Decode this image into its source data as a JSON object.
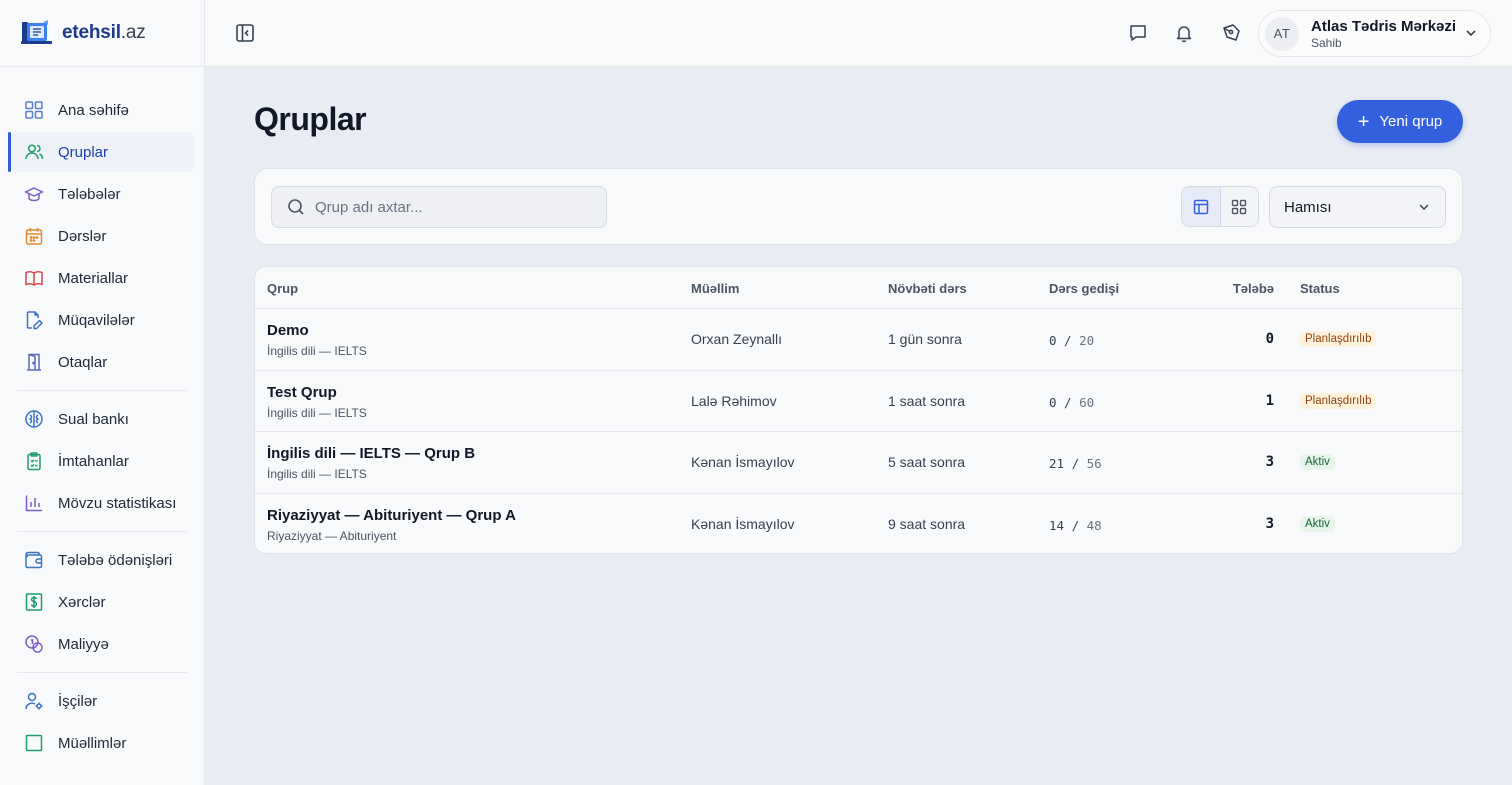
{
  "brand": {
    "name": "etehsil",
    "tld": ".az"
  },
  "sidebar": {
    "groups": [
      [
        {
          "label": "Ana səhifə",
          "icon": "grid-icon",
          "active": false
        },
        {
          "label": "Qruplar",
          "icon": "users-icon",
          "active": true
        },
        {
          "label": "Tələbələr",
          "icon": "graduation-cap-icon",
          "active": false
        },
        {
          "label": "Dərslər",
          "icon": "calendar-icon",
          "active": false
        },
        {
          "label": "Materiallar",
          "icon": "book-icon",
          "active": false
        },
        {
          "label": "Müqavilələr",
          "icon": "contract-icon",
          "active": false
        },
        {
          "label": "Otaqlar",
          "icon": "door-icon",
          "active": false
        }
      ],
      [
        {
          "label": "Sual bankı",
          "icon": "brain-icon",
          "active": false
        },
        {
          "label": "İmtahanlar",
          "icon": "clipboard-icon",
          "active": false
        },
        {
          "label": "Mövzu statistikası",
          "icon": "bar-chart-icon",
          "active": false
        }
      ],
      [
        {
          "label": "Tələbə ödənişləri",
          "icon": "wallet-icon",
          "active": false
        },
        {
          "label": "Xərclər",
          "icon": "dollar-icon",
          "active": false
        },
        {
          "label": "Maliyyə",
          "icon": "coins-icon",
          "active": false
        }
      ],
      [
        {
          "label": "İşçilər",
          "icon": "user-gear-icon",
          "active": false
        },
        {
          "label": "Müəllimlər",
          "icon": "teacher-icon",
          "active": false
        }
      ]
    ]
  },
  "user": {
    "initials": "AT",
    "name": "Atlas Tədris Mərkəzi",
    "role": "Sahib"
  },
  "page": {
    "title": "Qruplar",
    "new_button": "Yeni qrup"
  },
  "filters": {
    "search_placeholder": "Qrup adı axtar...",
    "status_value": "Hamısı"
  },
  "table": {
    "headers": {
      "group": "Qrup",
      "teacher": "Müəllim",
      "next": "Növbəti dərs",
      "progress": "Dərs gedişi",
      "students": "Tələbə",
      "status": "Status"
    },
    "rows": [
      {
        "name": "Demo",
        "course": "İngilis dili — IELTS",
        "teacher": "Orxan Zeynallı",
        "next": "1 gün sonra",
        "done": "0",
        "total": "20",
        "students": "0",
        "status": "Planlaşdırılıb",
        "status_kind": "planned"
      },
      {
        "name": "Test Qrup",
        "course": "İngilis dili — IELTS",
        "teacher": "Lalə Rəhimov",
        "next": "1 saat sonra",
        "done": "0",
        "total": "60",
        "students": "1",
        "status": "Planlaşdırılıb",
        "status_kind": "planned"
      },
      {
        "name": "İngilis dili — IELTS — Qrup B",
        "course": "İngilis dili — IELTS",
        "teacher": "Kənan İsmayılov",
        "next": "5 saat sonra",
        "done": "21",
        "total": "56",
        "students": "3",
        "status": "Aktiv",
        "status_kind": "active"
      },
      {
        "name": "Riyaziyyat — Abituriyent — Qrup A",
        "course": "Riyaziyyat — Abituriyent",
        "teacher": "Kənan İsmayılov",
        "next": "9 saat sonra",
        "done": "14",
        "total": "48",
        "students": "3",
        "status": "Aktiv",
        "status_kind": "active"
      }
    ]
  },
  "colors": {
    "accent": "#3460e0",
    "active_nav": "#1e40af"
  }
}
